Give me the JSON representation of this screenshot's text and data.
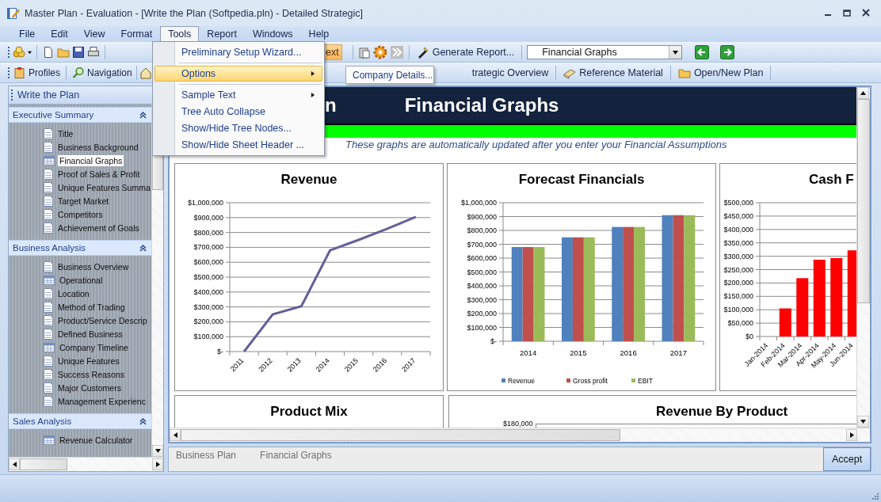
{
  "window": {
    "title": "Master Plan - Evaluation - [Write the Plan (Softpedia.pln) - Detailed Strategic]"
  },
  "menu_bar": [
    {
      "label": "File",
      "selected": false
    },
    {
      "label": "Edit",
      "selected": false
    },
    {
      "label": "View",
      "selected": false
    },
    {
      "label": "Format",
      "selected": false
    },
    {
      "label": "Tools",
      "selected": true
    },
    {
      "label": "Report",
      "selected": false
    },
    {
      "label": "Windows",
      "selected": false
    },
    {
      "label": "Help",
      "selected": false
    }
  ],
  "tools_menu": {
    "items": [
      {
        "kind": "item",
        "label": "Preliminary Setup Wizard...",
        "selected": false,
        "submenu": false
      },
      {
        "kind": "separator"
      },
      {
        "kind": "item",
        "label": "Options",
        "selected": true,
        "submenu": true
      },
      {
        "kind": "separator"
      },
      {
        "kind": "item",
        "label": "Sample Text",
        "selected": false,
        "submenu": true
      },
      {
        "kind": "item",
        "label": "Tree Auto Collapse",
        "selected": false,
        "submenu": false
      },
      {
        "kind": "item",
        "label": "Show/Hide Tree Nodes...",
        "selected": false,
        "submenu": false
      },
      {
        "kind": "item",
        "label": "Show/Hide Sheet Header ...",
        "selected": false,
        "submenu": false
      }
    ]
  },
  "submenu": {
    "items": [
      "Company Details..."
    ]
  },
  "toolbar": {
    "partial_button": "ext",
    "generate_report": "Generate Report...",
    "page_select": "Financial Graphs"
  },
  "navigation_bar": [
    {
      "label": "Profiles"
    },
    {
      "label": "Navigation"
    },
    {
      "label": "trategic Overview"
    },
    {
      "label": "Reference Material"
    },
    {
      "label": "Open/New Plan"
    }
  ],
  "sidebar": {
    "title": "Write the Plan",
    "sections": [
      {
        "label": "Executive Summary",
        "expanded": true,
        "children": [
          {
            "label": "Title",
            "kind": "doc",
            "selected": false
          },
          {
            "label": "Business Background",
            "kind": "doc",
            "selected": false
          },
          {
            "label": "Financial Graphs",
            "kind": "table",
            "selected": true
          },
          {
            "label": "Proof of Sales & Profit",
            "kind": "doc",
            "selected": false
          },
          {
            "label": "Unique Features Summa",
            "kind": "doc",
            "selected": false
          },
          {
            "label": "Target Market",
            "kind": "doc",
            "selected": false
          },
          {
            "label": "Competitors",
            "kind": "doc",
            "selected": false
          },
          {
            "label": "Achievement of Goals",
            "kind": "doc",
            "selected": false
          }
        ]
      },
      {
        "label": "Business Analysis",
        "expanded": true,
        "children": [
          {
            "label": "Business Overview",
            "kind": "doc",
            "selected": false
          },
          {
            "label": "Operational",
            "kind": "table",
            "selected": false
          },
          {
            "label": "Location",
            "kind": "doc",
            "selected": false
          },
          {
            "label": "Method of Trading",
            "kind": "doc",
            "selected": false
          },
          {
            "label": "Product/Service Descrip",
            "kind": "doc",
            "selected": false
          },
          {
            "label": "Defined Business",
            "kind": "doc",
            "selected": false
          },
          {
            "label": "Company Timeline",
            "kind": "table",
            "selected": false
          },
          {
            "label": "Unique Features",
            "kind": "doc",
            "selected": false
          },
          {
            "label": "Success Reasons",
            "kind": "doc",
            "selected": false
          },
          {
            "label": "Major Customers",
            "kind": "doc",
            "selected": false
          },
          {
            "label": "Management Experienc",
            "kind": "doc",
            "selected": false
          }
        ]
      },
      {
        "label": "Sales Analysis",
        "expanded": true,
        "children": [
          {
            "label": "Revenue Calculator",
            "kind": "table",
            "selected": false
          }
        ]
      }
    ]
  },
  "content": {
    "header_left": "n",
    "title": "Financial Graphs",
    "subtitle": "These graphs are automatically updated after you enter your Financial Assumptions",
    "charts": [
      {
        "chart_data": {
          "type": "line",
          "title": "Revenue",
          "grid": true,
          "categories": [
            "2011",
            "2012",
            "2013",
            "2014",
            "2015",
            "2016",
            "2017"
          ],
          "series": [
            {
              "color": "#64609a",
              "values": [
                0,
                250000,
                305000,
                680000,
                750000,
                825000,
                905000
              ]
            }
          ],
          "ylim": [
            0,
            1000000
          ],
          "yticks": [
            {
              "value": 0,
              "label": "$-"
            },
            {
              "value": 100000,
              "label": "$100,000"
            },
            {
              "value": 200000,
              "label": "$200,000"
            },
            {
              "value": 300000,
              "label": "$300,000"
            },
            {
              "value": 400000,
              "label": "$400,000"
            },
            {
              "value": 500000,
              "label": "$500,000"
            },
            {
              "value": 600000,
              "label": "$600,000"
            },
            {
              "value": 700000,
              "label": "$700,000"
            },
            {
              "value": 800000,
              "label": "$800,000"
            },
            {
              "value": 900000,
              "label": "$900,000"
            },
            {
              "value": 1000000,
              "label": "$1,000,000"
            }
          ]
        }
      },
      {
        "chart_data": {
          "type": "bar",
          "title": "Forecast Financials",
          "grid": true,
          "legend": "bottom",
          "categories": [
            "2014",
            "2015",
            "2016",
            "2017"
          ],
          "series": [
            {
              "name": "Revenue",
              "color": "#4f81bd",
              "values": [
                680000,
                750000,
                825000,
                910000
              ]
            },
            {
              "name": "Gross profit",
              "color": "#c0504d",
              "values": [
                680000,
                750000,
                825000,
                910000
              ]
            },
            {
              "name": "EBIT",
              "color": "#9bbb59",
              "values": [
                680000,
                750000,
                825000,
                910000
              ]
            }
          ],
          "ylim": [
            0,
            1000000
          ],
          "yticks": [
            {
              "value": 0,
              "label": "$-"
            },
            {
              "value": 100000,
              "label": "$100,000"
            },
            {
              "value": 200000,
              "label": "$200,000"
            },
            {
              "value": 300000,
              "label": "$300,000"
            },
            {
              "value": 400000,
              "label": "$400,000"
            },
            {
              "value": 500000,
              "label": "$500,000"
            },
            {
              "value": 600000,
              "label": "$600,000"
            },
            {
              "value": 700000,
              "label": "$700,000"
            },
            {
              "value": 800000,
              "label": "$800,000"
            },
            {
              "value": 900000,
              "label": "$900,000"
            },
            {
              "value": 1000000,
              "label": "$1,000,000"
            }
          ]
        }
      },
      {
        "chart_data": {
          "type": "bar",
          "title": "Cash F",
          "grid": true,
          "categories": [
            "Jan-2014",
            "Feb-2014",
            "Mar-2014",
            "Apr-2014",
            "May-2014",
            "Jun-2014"
          ],
          "series": [
            {
              "color": "#ff0000",
              "values": [
                null,
                105000,
                218000,
                287000,
                293000,
                322000
              ]
            }
          ],
          "ylim": [
            0,
            500000
          ],
          "yticks": [
            {
              "value": 0,
              "label": "$0"
            },
            {
              "value": 50000,
              "label": "$50,000"
            },
            {
              "value": 100000,
              "label": "$100,000"
            },
            {
              "value": 150000,
              "label": "$150,000"
            },
            {
              "value": 200000,
              "label": "$200,000"
            },
            {
              "value": 250000,
              "label": "$250,000"
            },
            {
              "value": 300000,
              "label": "$300,000"
            },
            {
              "value": 350000,
              "label": "$350,000"
            },
            {
              "value": 400000,
              "label": "$400,000"
            },
            {
              "value": 450000,
              "label": "$450,000"
            },
            {
              "value": 500000,
              "label": "$500,000"
            }
          ]
        }
      }
    ],
    "charts_row_2": [
      {
        "title": "Product Mix"
      },
      {
        "title": "Revenue By Product",
        "y_tick": "$180,000"
      }
    ]
  },
  "footer": {
    "breadcrumbs": [
      "Business Plan",
      "Financial Graphs"
    ],
    "accept": "Accept"
  }
}
